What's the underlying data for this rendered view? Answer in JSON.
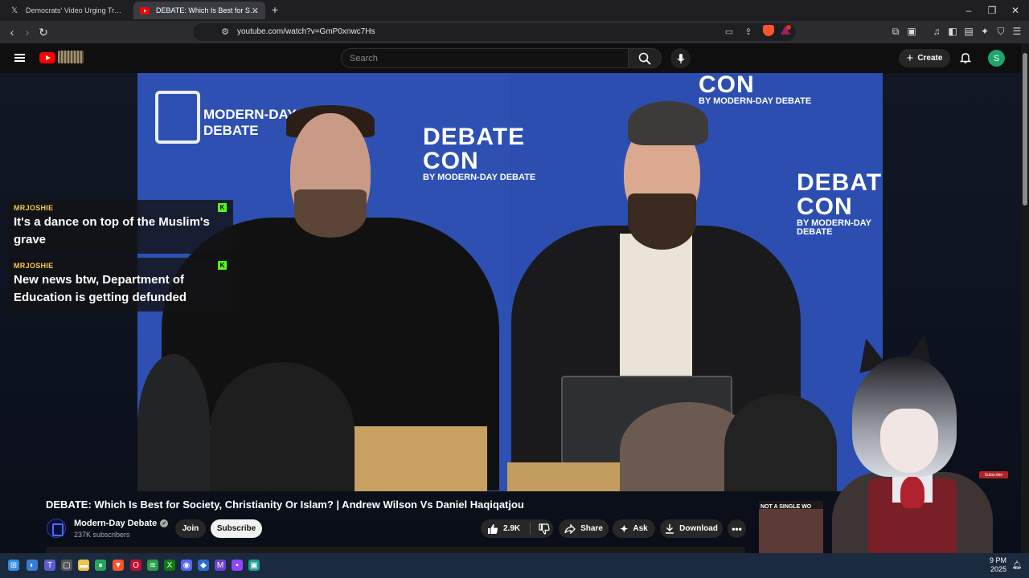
{
  "browser": {
    "tabs": [
      {
        "title": "Democrats' Video Urging Troops to R",
        "icon": "x-logo-icon",
        "active": false
      },
      {
        "title": "DEBATE: Which Is Best for Societ",
        "icon": "youtube-icon",
        "active": true
      }
    ],
    "url": "youtube.com/watch?v=GmP0xnwc7Hs",
    "brave_badge": "1"
  },
  "youtube": {
    "search_placeholder": "Search",
    "create_label": "Create",
    "avatar_letter": "S"
  },
  "chat": [
    {
      "user": "MRJOSHIE",
      "text": "It's a dance on top of the Muslim's grave"
    },
    {
      "user": "MRJOSHIE",
      "text": "New news btw, Department of Education is getting defunded"
    }
  ],
  "scene_text": {
    "brand_title_line1": "MODERN-DAY",
    "brand_title_line2": "DEBATE",
    "banner_big_1": "DEBATE",
    "banner_big_2": "CON",
    "banner_small": "BY MODERN-DAY DEBATE"
  },
  "video": {
    "title": "DEBATE: Which Is Best for Society, Christianity Or Islam? | Andrew Wilson Vs Daniel Haqiqatjou",
    "channel": "Modern-Day Debate",
    "subscribers": "237K subscribers",
    "join_label": "Join",
    "subscribe_label": "Subscribe",
    "likes": "2.9K",
    "share_label": "Share",
    "ask_label": "Ask",
    "download_label": "Download"
  },
  "side_video": {
    "caption": "NOT A SINGLE WO"
  },
  "overlay": {
    "mini_subscribe": "Subscribe"
  },
  "taskbar": {
    "time": "9 PM",
    "year": "2025"
  },
  "colors": {
    "accent": "#ff0000",
    "chat_user": "#f5c84c",
    "kick_green": "#53fc18",
    "stage_blue": "#2e50b3"
  }
}
